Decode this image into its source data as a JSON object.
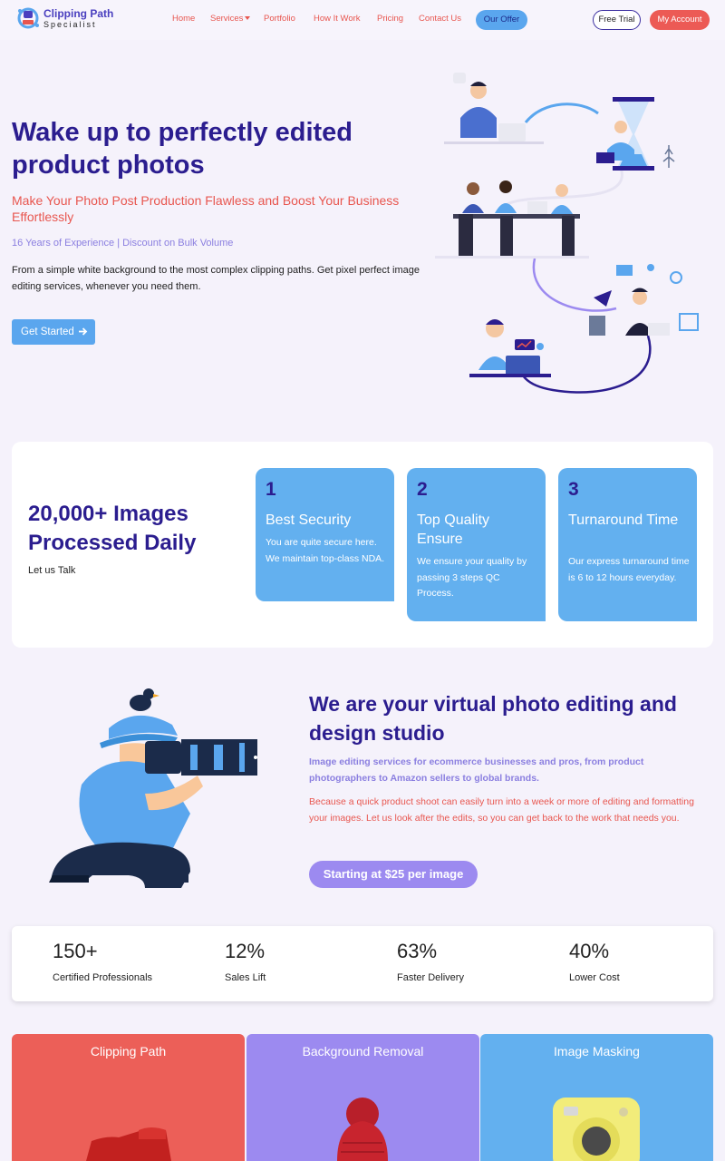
{
  "header": {
    "logo_line1": "Clipping Path",
    "logo_line2": "Specialist",
    "nav": [
      "Home",
      "Services",
      "Portfolio",
      "How It Work",
      "Pricing",
      "Contact Us"
    ],
    "our_offer": "Our Offer",
    "free_trial": "Free Trial",
    "my_account": "My Account"
  },
  "hero": {
    "title": "Wake up to perfectly edited product photos",
    "subtitle": "Make Your Photo Post Production Flawless and Boost Your Business Effortlessly",
    "experience": "16 Years of Experience | Discount on Bulk Volume",
    "description": "From a simple white background to the most complex clipping paths. Get pixel perfect image editing services, whenever you need them.",
    "cta": "Get Started"
  },
  "highlights": {
    "headline": "20,000+ Images Processed Daily",
    "talk": "Let us Talk",
    "features": [
      {
        "num": "1",
        "title": "Best Security",
        "text": "You are quite secure here. We maintain top-class NDA."
      },
      {
        "num": "2",
        "title": "Top Quality Ensure",
        "text": "We ensure your quality by passing 3 steps QC Process."
      },
      {
        "num": "3",
        "title": "Turnaround Time",
        "text": "Our express turnaround time is 6 to 12 hours everyday."
      }
    ]
  },
  "studio": {
    "title": "We are your virtual photo editing and design studio",
    "subtitle": "Image editing services for ecommerce businesses and pros, from product photographers to Amazon sellers to global brands.",
    "description": "Because a quick product shoot can easily turn into a week or more of editing and formatting your images. Let us look after the edits, so you can get back to the work that needs you.",
    "cta": "Starting at $25 per image"
  },
  "stats": [
    {
      "value": "150+",
      "label": "Certified Professionals"
    },
    {
      "value": "12%",
      "label": "Sales Lift"
    },
    {
      "value": "63%",
      "label": "Faster Delivery"
    },
    {
      "value": "40%",
      "label": "Lower Cost"
    }
  ],
  "services": [
    {
      "title": "Clipping Path",
      "color": "#ec5f58"
    },
    {
      "title": "Background Removal",
      "color": "#9c8af0"
    },
    {
      "title": "Image Masking",
      "color": "#63b0ef"
    }
  ],
  "colors": {
    "primary": "#2b1d8f",
    "accent_red": "#e8564f",
    "accent_blue": "#5aa6ee",
    "accent_purple": "#9c8af0"
  },
  "icons": {
    "get_started_arrow": "arrow-right-icon",
    "services_caret": "caret-down-icon"
  }
}
